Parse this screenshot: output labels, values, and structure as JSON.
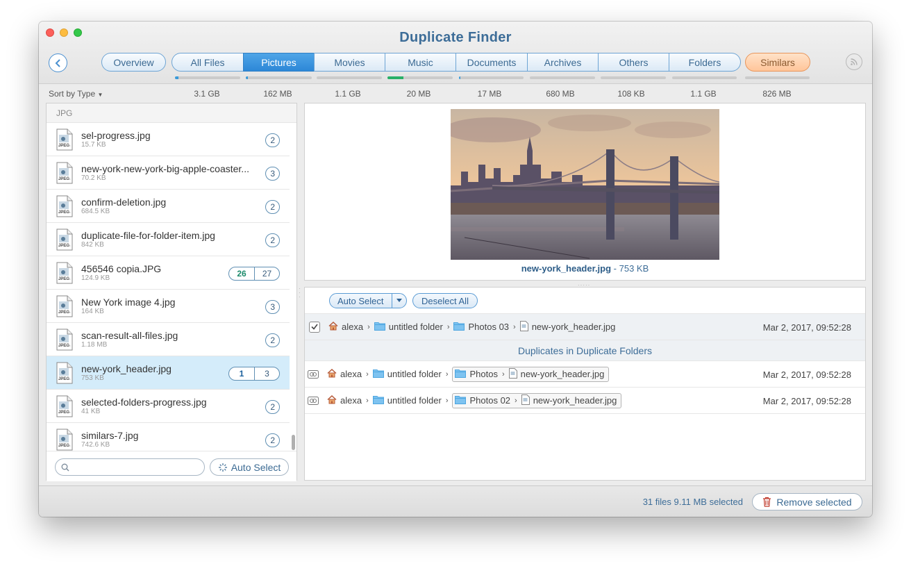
{
  "window": {
    "title": "Duplicate Finder"
  },
  "colors": {
    "accent": "#2d87d7",
    "title": "#3d6d98",
    "similars": "#ffc59a",
    "selected_row": "#d4ecfa"
  },
  "tabs": {
    "overview": "Overview",
    "items": [
      {
        "label": "All Files",
        "size": "3.1 GB",
        "progress": 0.05
      },
      {
        "label": "Pictures",
        "size": "162 MB",
        "progress": 0.03,
        "active": true
      },
      {
        "label": "Movies",
        "size": "1.1 GB",
        "progress": 0.0
      },
      {
        "label": "Music",
        "size": "20 MB",
        "progress": 0.24,
        "color": "green"
      },
      {
        "label": "Documents",
        "size": "17 MB",
        "progress": 0.02
      },
      {
        "label": "Archives",
        "size": "680 MB",
        "progress": 0.0
      },
      {
        "label": "Others",
        "size": "108 KB",
        "progress": 0.0
      },
      {
        "label": "Folders",
        "size": "1.1 GB",
        "progress": 0.0
      }
    ],
    "similars": {
      "label": "Similars",
      "size": "826 MB"
    }
  },
  "sort_label": "Sort by Type",
  "group_label": "JPG",
  "files": [
    {
      "name": "sel-progress.jpg",
      "size": "15.7 KB",
      "counts": [
        "2"
      ]
    },
    {
      "name": "new-york-new-york-big-apple-coaster...",
      "size": "70.2 KB",
      "counts": [
        "3"
      ]
    },
    {
      "name": "confirm-deletion.jpg",
      "size": "684.5 KB",
      "counts": [
        "2"
      ]
    },
    {
      "name": "duplicate-file-for-folder-item.jpg",
      "size": "842 KB",
      "counts": [
        "2"
      ]
    },
    {
      "name": "456546 copia.JPG",
      "size": "124.9 KB",
      "counts": [
        "26",
        "27"
      ]
    },
    {
      "name": "New York image 4.jpg",
      "size": "164 KB",
      "counts": [
        "3"
      ]
    },
    {
      "name": "scan-result-all-files.jpg",
      "size": "1.18 MB",
      "counts": [
        "2"
      ]
    },
    {
      "name": "new-york_header.jpg",
      "size": "753 KB",
      "counts": [
        "1",
        "3"
      ],
      "selected": true
    },
    {
      "name": "selected-folders-progress.jpg",
      "size": "41 KB",
      "counts": [
        "2"
      ]
    },
    {
      "name": "similars-7.jpg",
      "size": "742.6 KB",
      "counts": [
        "2"
      ]
    }
  ],
  "file_icon_label": "JPEG",
  "left_bottom": {
    "search_placeholder": "",
    "auto_select": "Auto Select"
  },
  "preview": {
    "filename": "new-york_header.jpg",
    "size_text": " - 753 KB"
  },
  "details": {
    "auto_select": "Auto Select",
    "deselect_all": "Deselect All",
    "original": {
      "user": "alexa",
      "folder1": "untitled folder",
      "folder2": "Photos 03",
      "file": "new-york_header.jpg",
      "date": "Mar 2, 2017, 09:52:28"
    },
    "dup_header": "Duplicates in Duplicate Folders",
    "duplicates": [
      {
        "user": "alexa",
        "folder1": "untitled folder",
        "folder2": "Photos",
        "file": "new-york_header.jpg",
        "date": "Mar 2, 2017, 09:52:28"
      },
      {
        "user": "alexa",
        "folder1": "untitled folder",
        "folder2": "Photos 02",
        "file": "new-york_header.jpg",
        "date": "Mar 2, 2017, 09:52:28"
      }
    ]
  },
  "status": {
    "selection": "31 files 9.11 MB selected",
    "remove": "Remove selected"
  }
}
